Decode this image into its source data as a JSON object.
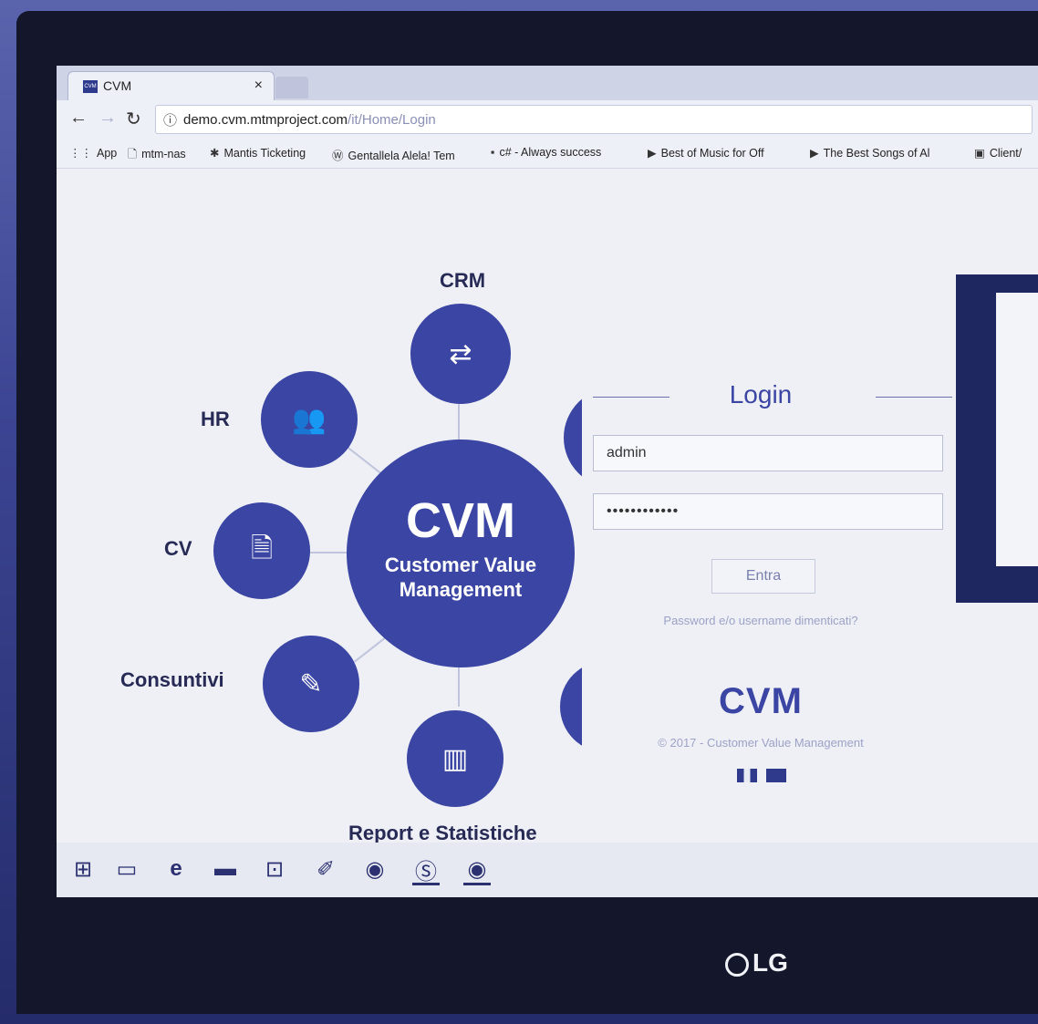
{
  "browser": {
    "tab_title": "CVM",
    "favicon_text": "CVM",
    "tab_close": "×",
    "url_host": "demo.cvm.mtmproject.com",
    "url_path": "/it/Home/Login"
  },
  "bookmarks": [
    {
      "icon": "apps-grid-icon",
      "label": "App"
    },
    {
      "icon": "page-icon",
      "label": "mtm-nas"
    },
    {
      "icon": "mantis-icon",
      "label": "Mantis Ticketing"
    },
    {
      "icon": "wordpress-icon",
      "label": "Gentallela Alela! Tem"
    },
    {
      "icon": "page-icon",
      "label": "c# - Always success"
    },
    {
      "icon": "youtube-icon",
      "label": "Best of Music for Off"
    },
    {
      "icon": "youtube-icon",
      "label": "The Best Songs of Al"
    },
    {
      "icon": "page-icon",
      "label": "Client/"
    }
  ],
  "diagram": {
    "hub_title": "CVM",
    "hub_subtitle_line1": "Customer Value",
    "hub_subtitle_line2": "Management",
    "nodes": [
      {
        "label": "CRM",
        "icon": "retweet-icon"
      },
      {
        "label": "HR",
        "icon": "users-icon"
      },
      {
        "label": "CV",
        "icon": "document-icon"
      },
      {
        "label": "Consuntivi",
        "icon": "edit-icon"
      },
      {
        "label": "Report e Statistiche",
        "icon": "bar-chart-icon"
      }
    ]
  },
  "login": {
    "title": "Login",
    "username_value": "admin",
    "password_value": "••••••••••••",
    "submit_label": "Entra",
    "forgot_link": "Password e/o username dimenticati?",
    "brand": "CVM",
    "copyright": "© 2017 - Customer Value Management"
  },
  "taskbar": {
    "icons": [
      "windows-start-icon",
      "task-view-icon",
      "edge-icon",
      "file-explorer-icon",
      "store-icon",
      "notes-icon",
      "chrome-icon",
      "skype-icon",
      "chrome-icon"
    ]
  },
  "monitor": {
    "brand": "LG"
  },
  "colors": {
    "accent": "#3b45a3",
    "dark": "#14162b"
  }
}
